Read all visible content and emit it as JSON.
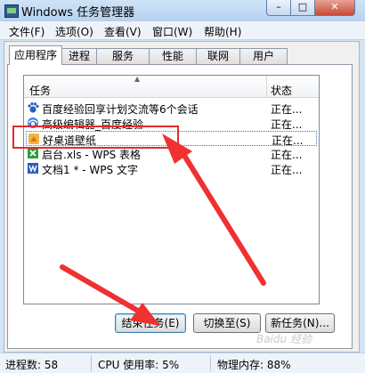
{
  "window": {
    "title": "Windows 任务管理器",
    "min": "–",
    "max": "□",
    "close": "✕"
  },
  "menu": [
    "文件(F)",
    "选项(O)",
    "查看(V)",
    "窗口(W)",
    "帮助(H)"
  ],
  "tabs": [
    "应用程序",
    "进程",
    "服务",
    "性能",
    "联网",
    "用户"
  ],
  "list": {
    "col_task": "任务",
    "col_status": "状态",
    "rows": [
      {
        "name": "百度经验回享计划交流等6个会话",
        "status": "正在..."
      },
      {
        "name": "高级编辑器_百度经验",
        "status": "正在..."
      },
      {
        "name": "好桌道壁纸",
        "status": "正在..."
      },
      {
        "name": "启台.xls - WPS 表格",
        "status": "正在..."
      },
      {
        "name": "文档1 * - WPS 文字",
        "status": "正在..."
      }
    ]
  },
  "buttons": {
    "end_task": "结束任务(E)",
    "switch_to": "切换至(S)",
    "new_task": "新任务(N)..."
  },
  "statusbar": {
    "processes": "进程数: 58",
    "cpu": "CPU 使用率: 5%",
    "memory": "物理内存: 88%"
  },
  "watermark": "Baidu 经验"
}
